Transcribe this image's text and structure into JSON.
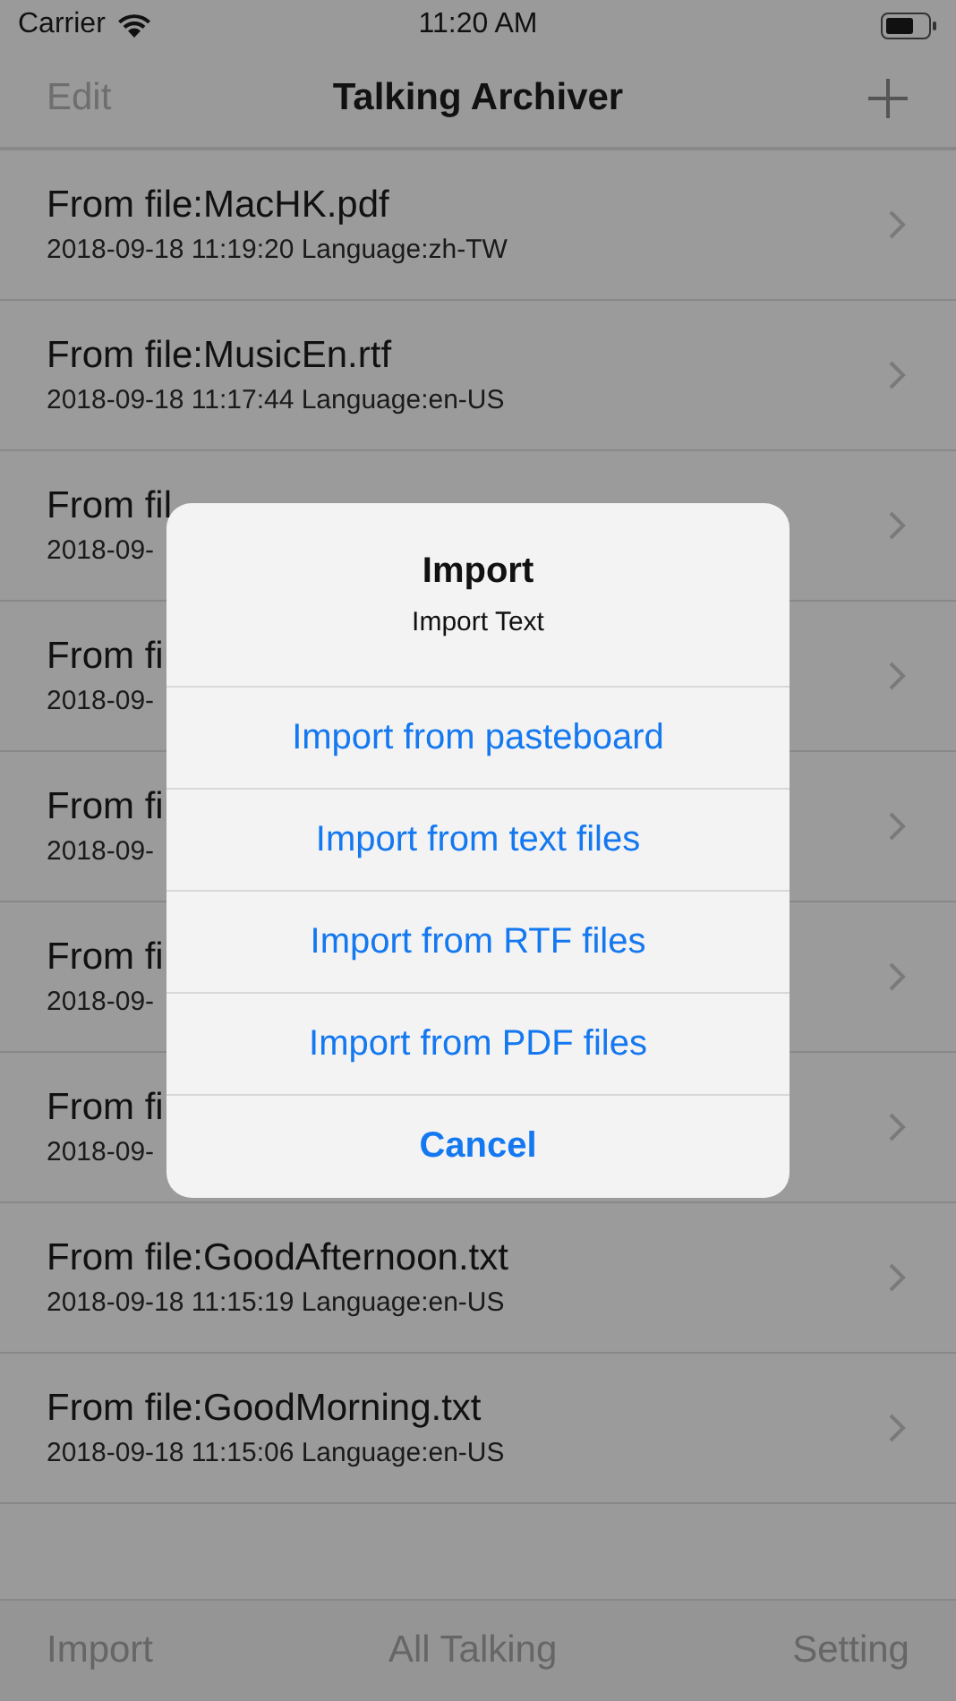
{
  "status_bar": {
    "carrier": "Carrier",
    "time": "11:20 AM"
  },
  "nav": {
    "left": "Edit",
    "title": "Talking Archiver"
  },
  "rows": [
    {
      "title": "From file:MacHK.pdf",
      "subtitle": "2018-09-18 11:19:20 Language:zh-TW"
    },
    {
      "title": "From file:MusicEn.rtf",
      "subtitle": "2018-09-18 11:17:44 Language:en-US"
    },
    {
      "title": "From fil",
      "subtitle": "2018-09-"
    },
    {
      "title": "From fi",
      "subtitle": "2018-09-"
    },
    {
      "title": "From fi",
      "subtitle": "2018-09-"
    },
    {
      "title": "From fi",
      "subtitle": "2018-09-"
    },
    {
      "title": "From fi",
      "subtitle": "2018-09-"
    },
    {
      "title": "From file:GoodAfternoon.txt",
      "subtitle": "2018-09-18 11:15:19 Language:en-US"
    },
    {
      "title": "From file:GoodMorning.txt",
      "subtitle": "2018-09-18 11:15:06 Language:en-US"
    }
  ],
  "alert": {
    "title": "Import",
    "message": "Import Text",
    "actions": [
      {
        "label": "Import from pasteboard",
        "kind": "default"
      },
      {
        "label": "Import from text files",
        "kind": "default"
      },
      {
        "label": "Import from RTF files",
        "kind": "default"
      },
      {
        "label": "Import from PDF files",
        "kind": "default"
      },
      {
        "label": "Cancel",
        "kind": "cancel"
      }
    ]
  },
  "tab_bar": [
    "Import",
    "All Talking",
    "Setting"
  ]
}
